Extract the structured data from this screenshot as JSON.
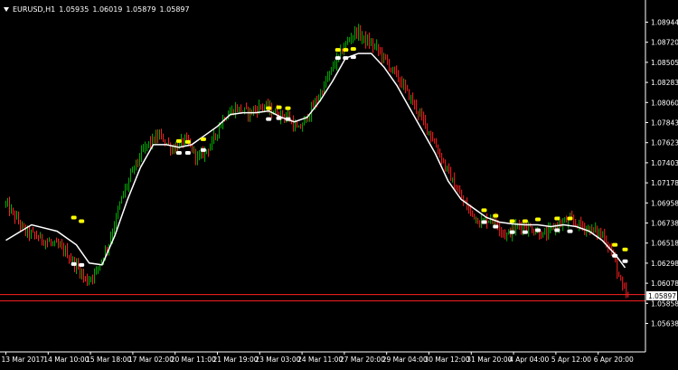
{
  "window": {
    "symbol": "EURUSD,H1",
    "ohlc": [
      "1.05935",
      "1.06019",
      "1.05879",
      "1.05897"
    ]
  },
  "colors": {
    "background": "#000000",
    "axis": "#ffffff",
    "bull_candle": "#00b000",
    "bear_candle": "#ff2020",
    "moving_average": "#ffffff",
    "upper_marker": "#ffff00",
    "lower_marker": "#ffffff",
    "bid_line": "#ff2020",
    "price_label_bg": "#ffffff",
    "price_label_text": "#000000"
  },
  "current_price": "1.05897",
  "chart_data": {
    "type": "line",
    "x_labels": [
      "13 Mar 2017",
      "14 Mar 10:00",
      "15 Mar 18:00",
      "17 Mar 02:00",
      "20 Mar 11:00",
      "21 Mar 19:00",
      "23 Mar 03:00",
      "24 Mar 11:00",
      "27 Mar 20:00",
      "29 Mar 04:00",
      "30 Mar 12:00",
      "31 Mar 20:00",
      "4 Apr 04:00",
      "5 Apr 12:00",
      "6 Apr 20:00"
    ],
    "y_ticks": [
      "1.08944",
      "1.08720",
      "1.08505",
      "1.08283",
      "1.08060",
      "1.07843",
      "1.07623",
      "1.07403",
      "1.07178",
      "1.06958",
      "1.06738",
      "1.06518",
      "1.06298",
      "1.06078",
      "1.05858",
      "1.05638"
    ],
    "ylim": [
      1.05638,
      1.08944
    ],
    "price_series": [
      [
        0,
        1.0695
      ],
      [
        1.5,
        1.0665
      ],
      [
        3,
        1.0655
      ],
      [
        4.5,
        1.0645
      ],
      [
        5.6,
        1.0625
      ],
      [
        6.3,
        1.061
      ],
      [
        7.0,
        1.062
      ],
      [
        8.0,
        1.065
      ],
      [
        9.0,
        1.07
      ],
      [
        10.0,
        1.0735
      ],
      [
        11.0,
        1.076
      ],
      [
        12.0,
        1.077
      ],
      [
        13.0,
        1.0755
      ],
      [
        14.0,
        1.0765
      ],
      [
        15.0,
        1.0745
      ],
      [
        16.0,
        1.076
      ],
      [
        17.0,
        1.079
      ],
      [
        18.0,
        1.08
      ],
      [
        19.0,
        1.0795
      ],
      [
        20.0,
        1.0803
      ],
      [
        21.0,
        1.0795
      ],
      [
        22.0,
        1.079
      ],
      [
        22.8,
        1.0775
      ],
      [
        23.5,
        1.079
      ],
      [
        24.5,
        1.0815
      ],
      [
        25.5,
        1.0845
      ],
      [
        26.5,
        1.087
      ],
      [
        27.3,
        1.0885
      ],
      [
        28.0,
        1.0875
      ],
      [
        29.0,
        1.0865
      ],
      [
        30.0,
        1.0845
      ],
      [
        31.0,
        1.0825
      ],
      [
        32.0,
        1.08
      ],
      [
        33.0,
        1.0775
      ],
      [
        34.0,
        1.0745
      ],
      [
        35.0,
        1.0715
      ],
      [
        36.0,
        1.069
      ],
      [
        37.0,
        1.0675
      ],
      [
        38.0,
        1.068
      ],
      [
        39.0,
        1.066
      ],
      [
        40.0,
        1.0672
      ],
      [
        41.0,
        1.0668
      ],
      [
        42.0,
        1.066
      ],
      [
        43.0,
        1.0672
      ],
      [
        44.0,
        1.0677
      ],
      [
        45.0,
        1.067
      ],
      [
        46.0,
        1.0665
      ],
      [
        46.6,
        1.066
      ],
      [
        47.4,
        1.0638
      ],
      [
        48.0,
        1.0605
      ],
      [
        48.6,
        1.059
      ]
    ],
    "moving_average": [
      [
        0,
        1.0655
      ],
      [
        2,
        1.0672
      ],
      [
        4,
        1.0665
      ],
      [
        5.5,
        1.065
      ],
      [
        6.5,
        1.063
      ],
      [
        7.5,
        1.0628
      ],
      [
        8.5,
        1.066
      ],
      [
        9.5,
        1.07
      ],
      [
        10.5,
        1.0735
      ],
      [
        11.5,
        1.076
      ],
      [
        12.5,
        1.076
      ],
      [
        13.5,
        1.0757
      ],
      [
        14.5,
        1.076
      ],
      [
        15.5,
        1.077
      ],
      [
        16.5,
        1.078
      ],
      [
        17.5,
        1.0793
      ],
      [
        18.5,
        1.0795
      ],
      [
        19.5,
        1.0795
      ],
      [
        20.5,
        1.0797
      ],
      [
        21.5,
        1.079
      ],
      [
        22.5,
        1.0785
      ],
      [
        23.5,
        1.079
      ],
      [
        24.5,
        1.0808
      ],
      [
        25.5,
        1.083
      ],
      [
        26.5,
        1.0855
      ],
      [
        27.5,
        1.086
      ],
      [
        28.5,
        1.086
      ],
      [
        29.5,
        1.0845
      ],
      [
        30.5,
        1.0825
      ],
      [
        31.5,
        1.08
      ],
      [
        32.5,
        1.0775
      ],
      [
        33.5,
        1.075
      ],
      [
        34.5,
        1.072
      ],
      [
        35.5,
        1.07
      ],
      [
        36.5,
        1.069
      ],
      [
        37.5,
        1.068
      ],
      [
        38.5,
        1.0675
      ],
      [
        39.5,
        1.0673
      ],
      [
        40.5,
        1.0672
      ],
      [
        41.5,
        1.0672
      ],
      [
        42.5,
        1.067
      ],
      [
        43.5,
        1.0672
      ],
      [
        44.5,
        1.067
      ],
      [
        45.5,
        1.0665
      ],
      [
        46.5,
        1.0655
      ],
      [
        47.5,
        1.064
      ],
      [
        48.3,
        1.0625
      ]
    ],
    "upper_marker_points": [
      [
        5.3,
        1.068
      ],
      [
        5.9,
        1.0676
      ],
      [
        13.5,
        1.0764
      ],
      [
        14.2,
        1.0763
      ],
      [
        15.4,
        1.0766
      ],
      [
        20.5,
        1.08
      ],
      [
        21.3,
        1.0801
      ],
      [
        22.0,
        1.08
      ],
      [
        25.9,
        1.0864
      ],
      [
        26.5,
        1.0864
      ],
      [
        27.1,
        1.0865
      ],
      [
        37.3,
        1.0688
      ],
      [
        38.2,
        1.0682
      ],
      [
        39.5,
        1.0676
      ],
      [
        40.5,
        1.0676
      ],
      [
        41.5,
        1.0678
      ],
      [
        43.0,
        1.0679
      ],
      [
        44.0,
        1.0679
      ],
      [
        47.5,
        1.065
      ],
      [
        48.3,
        1.0645
      ]
    ],
    "lower_marker_points": [
      [
        5.3,
        1.0629
      ],
      [
        5.9,
        1.0628
      ],
      [
        13.5,
        1.0751
      ],
      [
        14.2,
        1.0751
      ],
      [
        15.4,
        1.0754
      ],
      [
        20.5,
        1.0788
      ],
      [
        21.3,
        1.0789
      ],
      [
        22.0,
        1.0788
      ],
      [
        25.9,
        1.0855
      ],
      [
        26.5,
        1.0855
      ],
      [
        27.1,
        1.0856
      ],
      [
        37.3,
        1.0675
      ],
      [
        38.2,
        1.067
      ],
      [
        39.5,
        1.0664
      ],
      [
        40.5,
        1.0664
      ],
      [
        41.5,
        1.0666
      ],
      [
        43.0,
        1.0666
      ],
      [
        44.0,
        1.0665
      ],
      [
        47.5,
        1.0638
      ],
      [
        48.3,
        1.0632
      ]
    ],
    "horizontal_lines": [
      1.05955,
      1.05885
    ],
    "grid": false
  }
}
